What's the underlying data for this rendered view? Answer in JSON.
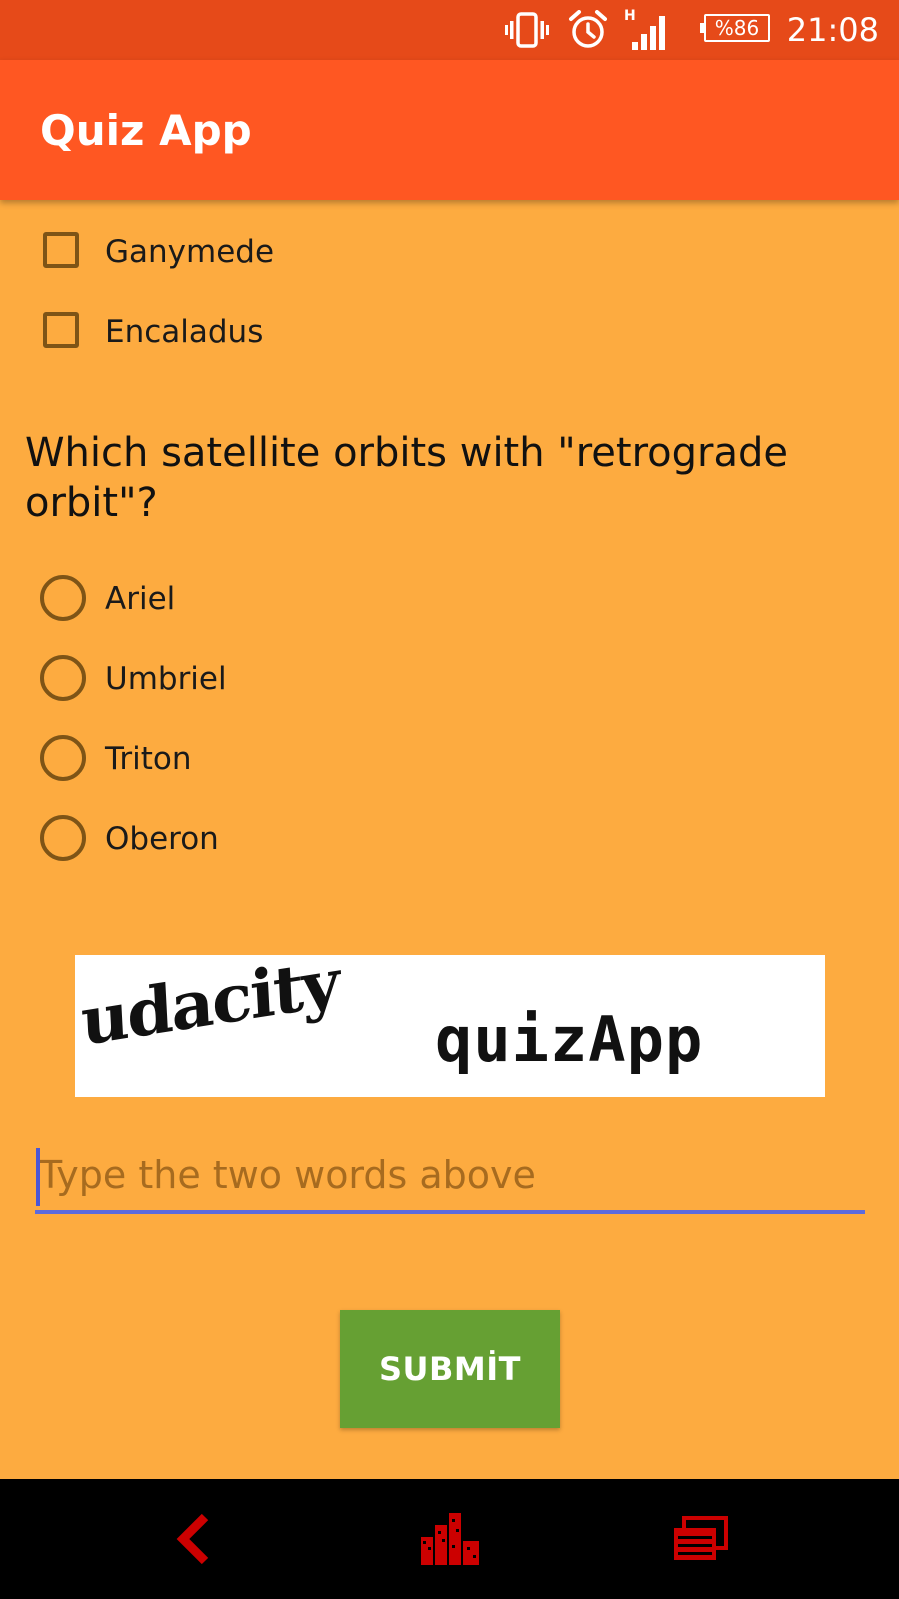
{
  "status_bar": {
    "time": "21:08",
    "battery": "%86",
    "icons": [
      "vibrate-icon",
      "alarm-icon",
      "signal-h-icon",
      "battery-icon"
    ]
  },
  "app_bar": {
    "title": "Quiz App"
  },
  "previous_question": {
    "options": [
      {
        "label": "Ganymede",
        "checked": false
      },
      {
        "label": "Encaladus",
        "checked": false
      }
    ]
  },
  "question": {
    "text": "Which satellite orbits with \"retrograde orbit\"?",
    "options": [
      {
        "label": "Ariel",
        "selected": false
      },
      {
        "label": "Umbriel",
        "selected": false
      },
      {
        "label": "Triton",
        "selected": false
      },
      {
        "label": "Oberon",
        "selected": false
      }
    ]
  },
  "captcha": {
    "word1": "udacity",
    "word2": "quizApp",
    "input_value": "",
    "input_placeholder": "Type the two words above"
  },
  "submit": {
    "label": "SUBMİT"
  },
  "nav_bar": {
    "icons": [
      "back-icon",
      "home-icon",
      "recents-icon"
    ],
    "color": "#CC0000"
  },
  "colors": {
    "status_bar": "#E64A19",
    "app_bar": "#FF5722",
    "background": "#FDAB40",
    "control": "#7E5416",
    "input_underline": "#5C6BDE",
    "submit": "#66A033"
  }
}
